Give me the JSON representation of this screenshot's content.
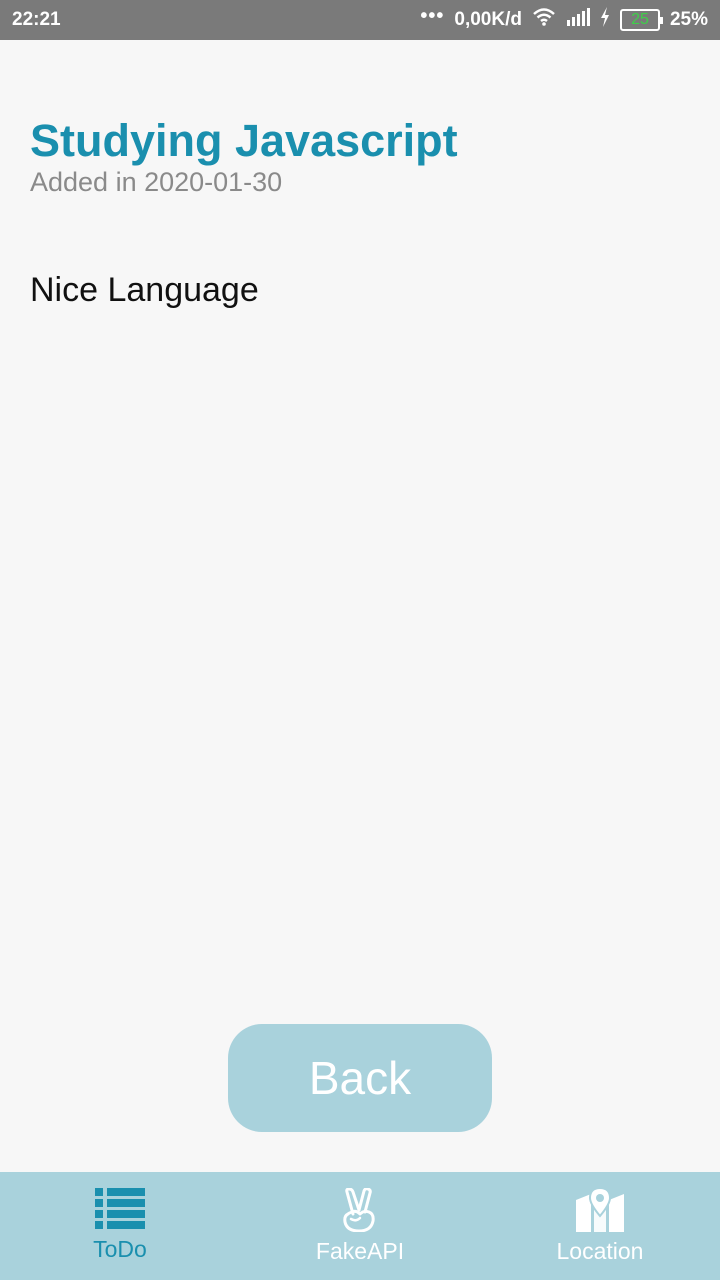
{
  "status_bar": {
    "time": "22:21",
    "dots": "•••",
    "network_speed": "0,00K/d",
    "battery_level": "25",
    "battery_percent": "25%"
  },
  "todo": {
    "title": "Studying Javascript",
    "added": "Added in 2020-01-30",
    "description": "Nice Language"
  },
  "back_button": {
    "label": "Back"
  },
  "tabs": [
    {
      "label": "ToDo",
      "icon": "list-icon",
      "active": true
    },
    {
      "label": "FakeAPI",
      "icon": "peace-hand-icon",
      "active": false
    },
    {
      "label": "Location",
      "icon": "map-pin-icon",
      "active": false
    }
  ],
  "colors": {
    "accent": "#1a8fae",
    "tab_bar": "#a9d2dc",
    "button": "#a9d2dc",
    "status_bar": "#7a7a7a",
    "background": "#f7f7f7"
  }
}
